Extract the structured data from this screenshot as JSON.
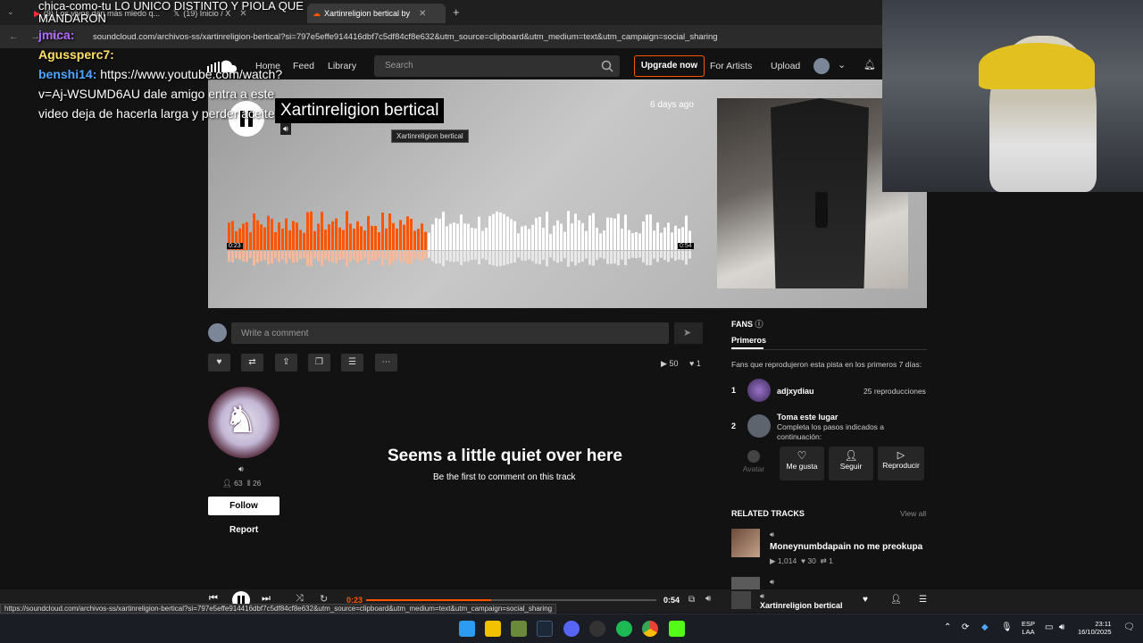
{
  "browser": {
    "tabs": [
      {
        "label": "(9) Los vivos dan más miedo q..."
      },
      {
        "label": "(19) Inicio / X"
      },
      {
        "label": "Xartinreligion bertical by"
      }
    ],
    "url": "soundcloud.com/archivos-ss/xartinreligion-bertical?si=797e5effe914416dbf7c5df84cf8e632&utm_source=clipboard&utm_medium=text&utm_campaign=social_sharing",
    "status_url": "https://soundcloud.com/archivos-ss/xartinreligion-bertical?si=797e5effe914416dbf7c5df84cf8e632&utm_source=clipboard&utm_medium=text&utm_campaign=social_sharing"
  },
  "header": {
    "nav": [
      "Home",
      "Feed",
      "Library"
    ],
    "search_placeholder": "Search",
    "upgrade": "Upgrade now",
    "for_artists": "For Artists",
    "upload": "Upload"
  },
  "hero": {
    "title": "Xartinreligion bertical",
    "tooltip": "Xartinreligion bertical",
    "posted": "6 days ago",
    "time_current": "0:23",
    "time_total": "0:54",
    "progress": 0.43
  },
  "comment": {
    "placeholder": "Write a comment"
  },
  "stats": {
    "plays": "50",
    "likes": "1"
  },
  "artist": {
    "followers": "63",
    "tracks": "26",
    "follow": "Follow",
    "report": "Report"
  },
  "empty": {
    "title": "Seems a little quiet over here",
    "subtitle": "Be the first to comment on this track"
  },
  "fans": {
    "label": "FANS",
    "tab": "Primeros",
    "description": "Fans que reprodujeron esta pista en los primeros 7 días:",
    "list": [
      {
        "rank": "1",
        "name": "adjxydiau",
        "plays": "25 reproducciones"
      },
      {
        "rank": "2",
        "name": "Toma este lugar",
        "desc1": "Completa los pasos indicados a",
        "desc2": "continuación:"
      }
    ],
    "steps": [
      "Avatar",
      "Me gusta",
      "Seguir",
      "Reproducir"
    ]
  },
  "related": {
    "label": "RELATED TRACKS",
    "view_all": "View all",
    "track_title": "Moneynumbdapain no me preokupa",
    "plays": "1,014",
    "likes": "30",
    "reposts": "1"
  },
  "player": {
    "current": "0:23",
    "total": "0:54",
    "progress": 0.43,
    "title": "Xartinreligion bertical"
  },
  "taskbar": {
    "lang1": "ESP",
    "lang2": "LAA",
    "time": "23:11",
    "date": "16/10/2025"
  },
  "chat": [
    {
      "user": "",
      "text": "chica-como-tu LO UNICO DISTINTO Y PIOLA QUE"
    },
    {
      "user": "",
      "text": "MANDARON"
    },
    {
      "user": "jmica:",
      "text": "",
      "color": "#b06bff"
    },
    {
      "user": "Agussperc7:",
      "text": "",
      "color": "#ffe066"
    },
    {
      "user": "benshi14:",
      "text": "https://www.youtube.com/watch?",
      "color": "#4da6ff"
    },
    {
      "user": "",
      "text": "v=Aj-WSUMD6AU dale amigo entra a este"
    },
    {
      "user": "",
      "text": "video deja de hacerla larga y perder aceite"
    }
  ],
  "colors": {
    "accent": "#ff5500",
    "bg": "#121212"
  }
}
